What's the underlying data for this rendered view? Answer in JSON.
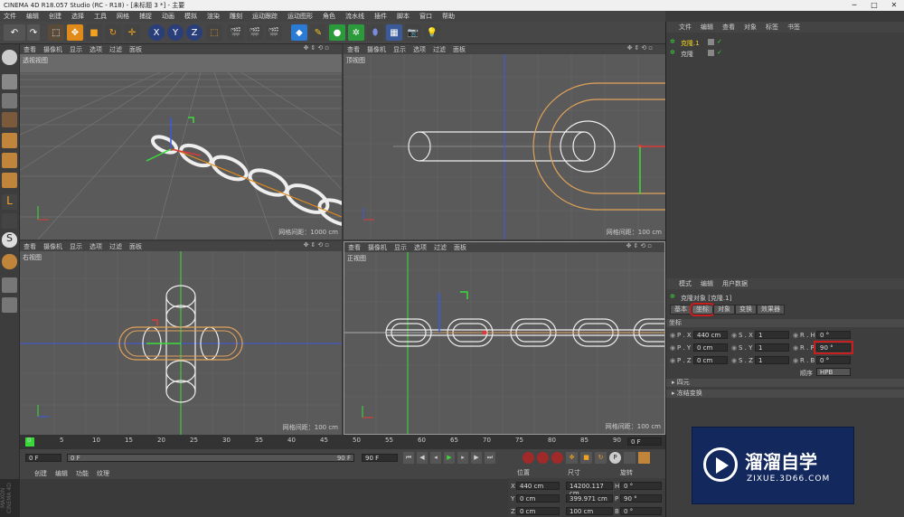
{
  "app": {
    "title": "CINEMA 4D R18.057 Studio (RC - R18) - [未标题 3 *] - 主要"
  },
  "menubar": [
    "文件",
    "编辑",
    "创建",
    "选择",
    "工具",
    "网格",
    "捕捉",
    "动画",
    "模拟",
    "渲染",
    "雕刻",
    "运动跟踪",
    "运动图形",
    "角色",
    "流水线",
    "插件",
    "脚本",
    "窗口",
    "帮助"
  ],
  "viewport_menu": [
    "查看",
    "摄像机",
    "显示",
    "选项",
    "过滤",
    "面板"
  ],
  "viewports": [
    {
      "label": "透视视图",
      "footer": "网格间距：1000 cm"
    },
    {
      "label": "顶视图",
      "footer": "网格间距：100 cm"
    },
    {
      "label": "右视图",
      "footer": "网格间距：100 cm"
    },
    {
      "label": "正视图",
      "footer": "网格间距：100 cm"
    }
  ],
  "object_manager": {
    "menu": [
      "文件",
      "编辑",
      "查看",
      "对象",
      "标签",
      "书签"
    ],
    "objects": [
      "克隆.1",
      "克隆"
    ]
  },
  "attributes": {
    "menu": [
      "模式",
      "编辑",
      "用户数据"
    ],
    "object_title": "克隆对象 [克隆.1]",
    "tabs": [
      "基本",
      "坐标",
      "对象",
      "变换",
      "效果器"
    ],
    "section": "坐标",
    "p": {
      "x_label": "P . X",
      "x": "440 cm",
      "y_label": "P . Y",
      "y": "0 cm",
      "z_label": "P . Z",
      "z": "0 cm"
    },
    "s": {
      "x_label": "S . X",
      "x": "1",
      "y_label": "S . Y",
      "y": "1",
      "z_label": "S . Z",
      "z": "1"
    },
    "r": {
      "h_label": "R . H",
      "h": "0 °",
      "p_label": "R . P",
      "p": "90 °",
      "b_label": "R . B",
      "b": "0 °"
    },
    "order_label": "顺序",
    "order_value": "HPB",
    "collapsed": [
      "四元",
      "冻结变换"
    ]
  },
  "timeline": {
    "ticks": [
      "0",
      "5",
      "10",
      "15",
      "20",
      "25",
      "30",
      "35",
      "40",
      "45",
      "50",
      "55",
      "60",
      "65",
      "70",
      "75",
      "80",
      "85",
      "90"
    ],
    "end": "0 F"
  },
  "controls": {
    "start": "0 F",
    "current": "0 F",
    "max": "90 F",
    "end": "90 F"
  },
  "material_menu": [
    "创建",
    "编辑",
    "功能",
    "纹理"
  ],
  "coordinates": {
    "headers": [
      "位置",
      "尺寸",
      "旋转"
    ],
    "rows": [
      {
        "a": "X",
        "pos": "440 cm",
        "size": "14200.117 cm",
        "rl": "H",
        "rot": "0 °"
      },
      {
        "a": "Y",
        "pos": "0 cm",
        "size": "399.971 cm",
        "rl": "P",
        "rot": "90 °"
      },
      {
        "a": "Z",
        "pos": "0 cm",
        "size": "100 cm",
        "rl": "B",
        "rot": "0 °"
      }
    ]
  },
  "watermark": {
    "title": "溜溜自学",
    "url": "ZIXUE.3D66.COM"
  },
  "maxon": "MAXON CINEMA 4D"
}
